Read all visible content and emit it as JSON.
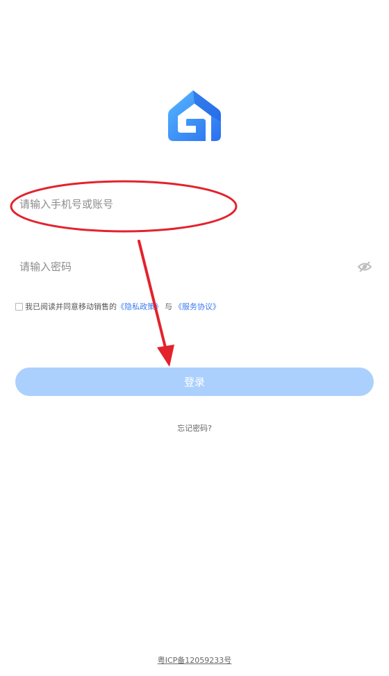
{
  "login_form": {
    "account_placeholder": "请输入手机号或账号",
    "password_placeholder": "请输入密码",
    "password_visibility_icon": "eye-closed-icon",
    "agreement": {
      "checked": false,
      "prefix": "我已阅读并同意移动销售的",
      "privacy_link": "《隐私政策》",
      "joiner": "与",
      "service_link": "《服务协议》"
    },
    "login_button": "登录",
    "forgot_password": "忘记密码?"
  },
  "footer": {
    "icp_text": "粤ICP备12059233号"
  },
  "colors": {
    "brand_blue": "#2f7cf6",
    "brand_light_blue": "#4fb0ff",
    "button_disabled": "#abd0fd",
    "link": "#3a7bf0",
    "annotation_red": "#e3222c"
  },
  "icons": {
    "logo": "house-logo-icon"
  }
}
